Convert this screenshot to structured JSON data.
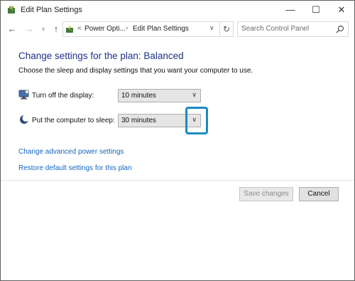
{
  "window": {
    "title": "Edit Plan Settings",
    "controls": {
      "minimize": "—",
      "maximize": "☐",
      "close": "✕"
    }
  },
  "address_bar": {
    "breadcrumb_prefix": "«",
    "breadcrumbs": [
      "Power Opti...",
      "Edit Plan Settings"
    ],
    "separator": "›",
    "search_placeholder": "Search Control Panel"
  },
  "main": {
    "heading": "Change settings for the plan: Balanced",
    "description": "Choose the sleep and display settings that you want your computer to use.",
    "settings": [
      {
        "label": "Turn off the display:",
        "value": "10 minutes",
        "icon": "display-icon"
      },
      {
        "label": "Put the computer to sleep:",
        "value": "30 minutes",
        "icon": "sleep-moon-icon"
      }
    ],
    "links": {
      "advanced": "Change advanced power settings",
      "restore": "Restore default settings for this plan"
    }
  },
  "footer": {
    "save_label": "Save changes",
    "save_enabled": false,
    "cancel_label": "Cancel"
  },
  "colors": {
    "heading": "#1e3287",
    "link": "#1565c0",
    "highlight": "#1a8bc4"
  }
}
